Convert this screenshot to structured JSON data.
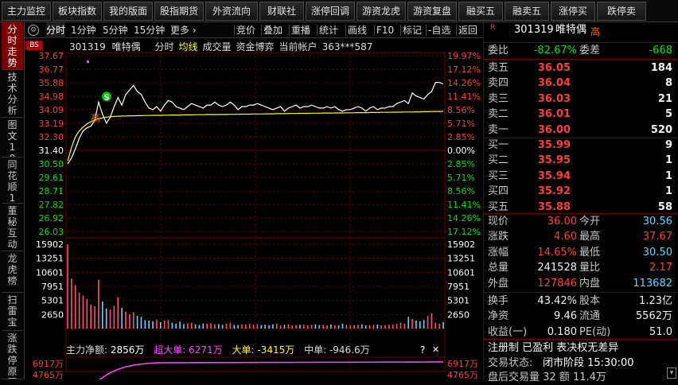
{
  "top_buttons": [
    "主力监控",
    "板块指数",
    "我的版面",
    "股指期货",
    "外资流向",
    "财联社",
    "涨停回调",
    "游资龙虎",
    "游资复盘",
    "融买五",
    "融卖五",
    "涨停买",
    "跌停卖"
  ],
  "left_tabs": [
    "分时走势",
    "技术分析",
    "图文10",
    "同花顺10",
    "董秘互动",
    "龙虎榜",
    "扫雷宝",
    "涨跌停原因"
  ],
  "toolbar2": {
    "items": [
      "分时",
      "1分钟",
      "5分钟",
      "15分钟",
      "更多 ›",
      "竞价",
      "叠加",
      "重播",
      "统计",
      "画线",
      "F10",
      "标记",
      "-自选",
      "返回"
    ],
    "badge": "BS"
  },
  "chart_header": {
    "code": "301319",
    "name": "唯特偶",
    "items": [
      "分时",
      "均线",
      "成交量",
      "资金博弈",
      "当前帐户",
      "363***587"
    ]
  },
  "chart_data": {
    "type": "line",
    "price_axis": {
      "left": [
        "37.67",
        "36.77",
        "35.88",
        "34.98",
        "34.09",
        "33.19",
        "32.30",
        "31.40",
        "30.50",
        "29.61",
        "28.71",
        "27.82",
        "26.92",
        "26.03"
      ],
      "right": [
        "19.97%",
        "17.12%",
        "14.26%",
        "11.41%",
        "8.56%",
        "5.71%",
        "2.85%",
        "0.00%",
        "2.85%",
        "5.71%",
        "8.56%",
        "11.41%",
        "14.26%",
        "17.12%"
      ],
      "min": 26.03,
      "max": 37.67,
      "preclose": 31.4
    },
    "volume_axis": {
      "labels": [
        "15902",
        "13251",
        "10601",
        "7951",
        "5301",
        "2650"
      ],
      "max": 15902
    },
    "price_series": [
      30.5,
      30.9,
      31.5,
      32.2,
      32.7,
      32.9,
      33.0,
      33.4,
      34.6,
      33.8,
      33.2,
      33.6,
      34.3,
      34.9,
      34.4,
      35.1,
      35.4,
      35.7,
      35.3,
      35.1,
      34.6,
      34.2,
      34.1,
      34.3,
      34.0,
      34.4,
      34.7,
      34.6,
      34.3,
      34.2,
      34.1,
      34.3,
      34.5,
      34.4,
      34.3,
      34.2,
      34.4,
      34.4,
      34.6,
      34.4,
      34.3,
      34.4,
      34.6,
      34.4,
      34.1,
      34.3,
      34.3,
      34.4,
      34.4,
      34.5,
      34.4,
      34.3,
      34.2,
      34.1,
      34.2,
      34.3,
      34.0,
      34.2,
      34.3,
      34.4,
      34.2,
      34.3,
      34.3,
      34.4,
      34.3,
      34.2,
      34.2,
      34.3,
      34.2,
      34.3,
      34.1,
      34.0,
      34.1,
      34.1,
      34.2,
      34.3,
      34.2,
      34.0,
      34.2,
      34.3,
      34.1,
      34.2,
      34.2,
      34.3,
      34.3,
      34.5,
      34.6,
      34.7,
      34.5,
      35.2,
      35.0,
      34.9,
      34.8,
      35.1,
      35.3,
      35.9,
      35.9,
      35.8
    ],
    "avg_series": [
      30.7,
      31.6,
      32.3,
      32.7,
      32.95,
      33.15,
      33.3,
      33.4,
      33.5,
      33.55,
      33.6,
      33.63,
      33.65,
      33.66,
      33.67,
      33.68,
      33.69,
      33.69,
      33.7,
      33.7,
      33.71,
      33.71,
      33.72,
      33.72,
      33.72,
      33.73,
      33.73,
      33.74,
      33.74,
      33.74,
      33.75,
      33.75,
      33.75,
      33.76,
      33.76,
      33.76,
      33.77,
      33.77,
      33.77,
      33.78,
      33.78,
      33.78,
      33.79,
      33.79,
      33.79,
      33.8,
      33.8,
      33.8,
      33.81,
      33.81,
      33.81,
      33.82,
      33.82,
      33.82,
      33.83,
      33.83,
      33.83,
      33.84,
      33.84,
      33.84,
      33.85,
      33.85,
      33.85,
      33.86,
      33.86,
      33.86,
      33.87,
      33.87,
      33.87,
      33.88,
      33.88,
      33.88,
      33.89,
      33.89,
      33.89,
      33.9,
      33.9,
      33.9,
      33.91,
      33.91,
      33.91,
      33.92,
      33.92,
      33.92,
      33.93,
      33.93,
      33.93,
      33.94,
      33.94,
      33.94,
      33.95,
      33.95,
      33.96,
      33.96,
      33.97,
      33.98,
      33.98,
      33.99
    ],
    "volume_series": [
      15902,
      9400,
      8200,
      6800,
      6200,
      5600,
      4500,
      4200,
      9200,
      5100,
      3800,
      3600,
      4300,
      5900,
      3900,
      3200,
      2700,
      3100,
      2400,
      2200,
      1600,
      1500,
      1400,
      1700,
      1200,
      1500,
      1600,
      1100,
      900,
      1300,
      850,
      1000,
      1100,
      800,
      700,
      950,
      900,
      1000,
      800,
      850,
      700,
      900,
      1100,
      700,
      650,
      800,
      750,
      900,
      700,
      850,
      650,
      700,
      600,
      800,
      900,
      600,
      700,
      800,
      600,
      650,
      700,
      750,
      600,
      700,
      800,
      650,
      700,
      600,
      750,
      650,
      600,
      900,
      700,
      650,
      600,
      700,
      800,
      600,
      650,
      700,
      750,
      600,
      650,
      700,
      800,
      900,
      1100,
      900,
      2200,
      1800,
      1500,
      1400,
      1600,
      2400,
      2900,
      1100,
      900,
      1200
    ],
    "markers": [
      {
        "text": "S"
      },
      {
        "text": "高"
      }
    ]
  },
  "fund_bar": {
    "main_label": "主力净额:",
    "main_value": "2856万",
    "super_label": "超大单:",
    "super_value": "6271万",
    "large_label": "大单:",
    "large_value": "-3415万",
    "mid_label": "中单:",
    "mid_value": "-946.6万",
    "help": "?",
    "close": "✕",
    "axis_left": [
      "6917万",
      "4765万"
    ],
    "axis_right": [
      "6917万",
      "4765万"
    ]
  },
  "quote": {
    "r_badge": "R",
    "code": "301319",
    "name": "唯特偶",
    "tag": "高",
    "weibi_label": "委比",
    "weibi_value": "-82.67%",
    "weicha_label": "委差",
    "weicha_value": "-668",
    "asks": [
      {
        "label": "卖五",
        "price": "36.05",
        "vol": "184"
      },
      {
        "label": "卖四",
        "price": "36.04",
        "vol": "8"
      },
      {
        "label": "卖三",
        "price": "36.03",
        "vol": "21"
      },
      {
        "label": "卖二",
        "price": "36.01",
        "vol": "5"
      },
      {
        "label": "卖一",
        "price": "36.00",
        "vol": "520"
      }
    ],
    "bids": [
      {
        "label": "买一",
        "price": "35.99",
        "vol": "9"
      },
      {
        "label": "买二",
        "price": "35.95",
        "vol": "1"
      },
      {
        "label": "买三",
        "price": "35.94",
        "vol": "1"
      },
      {
        "label": "买四",
        "price": "35.92",
        "vol": "1"
      },
      {
        "label": "买五",
        "price": "35.88",
        "vol": "58"
      }
    ],
    "stats": [
      {
        "l1": "现价",
        "v1": "36.00",
        "c1": "red",
        "l2": "今开",
        "v2": "30.56",
        "c2": "cyan"
      },
      {
        "l1": "涨跌",
        "v1": "4.60",
        "c1": "red",
        "l2": "最高",
        "v2": "37.67",
        "c2": "red"
      },
      {
        "l1": "涨幅",
        "v1": "14.65%",
        "c1": "red",
        "l2": "最低",
        "v2": "30.50",
        "c2": "cyan"
      },
      {
        "l1": "总量",
        "v1": "241528",
        "c1": "wht",
        "l2": "量比",
        "v2": "2.17",
        "c2": "red"
      },
      {
        "l1": "外盘",
        "v1": "127846",
        "c1": "red",
        "l2": "内盘",
        "v2": "113682",
        "c2": "cyan"
      },
      {
        "l1": "换手",
        "v1": "43.42%",
        "c1": "wht",
        "l2": "股本",
        "v2": "1.23亿",
        "c2": "wht"
      },
      {
        "l1": "净资",
        "v1": "9.46",
        "c1": "wht",
        "l2": "流通",
        "v2": "5562万",
        "c2": "wht"
      },
      {
        "l1": "收益(一)",
        "v1": "0.180",
        "c1": "wht",
        "l2": "PE(动)",
        "v2": "51.0",
        "c2": "wht"
      }
    ],
    "footer1": "注册制 已盈利 表决权无差异",
    "footer2_label": "交易状态:",
    "footer2_value": "闭市阶段 15:30:00",
    "footer3": "盘后交易量 32 额 11.4万"
  },
  "colors": {
    "up": "#ff3c3c",
    "down": "#00e600",
    "price_line": "#ffffff",
    "avg_line": "#ffff00",
    "grid": "#6b0000",
    "fund_line": "#ff44ff"
  }
}
